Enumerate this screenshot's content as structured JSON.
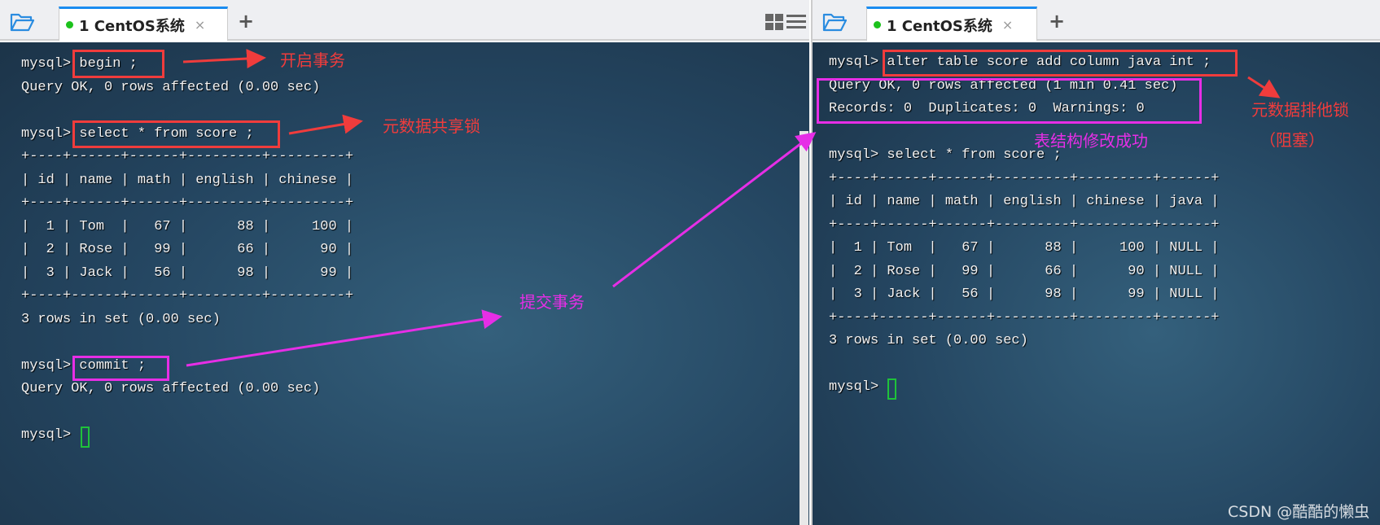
{
  "left": {
    "tab": {
      "label": "1 CentOS系统",
      "close": "×",
      "new": "+",
      "status_color": "#1cc21c"
    },
    "lines": [
      "mysql> begin ;",
      "Query OK, 0 rows affected (0.00 sec)",
      "",
      "mysql> select * from score ;",
      "+----+------+------+---------+---------+",
      "| id | name | math | english | chinese |",
      "+----+------+------+---------+---------+",
      "|  1 | Tom  |   67 |      88 |     100 |",
      "|  2 | Rose |   99 |      66 |      90 |",
      "|  3 | Jack |   56 |      98 |      99 |",
      "+----+------+------+---------+---------+",
      "3 rows in set (0.00 sec)",
      "",
      "mysql> commit ;",
      "Query OK, 0 rows affected (0.00 sec)",
      "",
      "mysql> "
    ],
    "annotations": {
      "begin": "开启事务",
      "shared_lock": "元数据共享锁",
      "commit": "提交事务"
    }
  },
  "right": {
    "tab": {
      "label": "1 CentOS系统",
      "close": "×",
      "new": "+",
      "status_color": "#1cc21c"
    },
    "lines": [
      "mysql> alter table score add column java int ;",
      "Query OK, 0 rows affected (1 min 0.41 sec)",
      "Records: 0  Duplicates: 0  Warnings: 0",
      "",
      "mysql> select * from score ;",
      "+----+------+------+---------+---------+------+",
      "| id | name | math | english | chinese | java |",
      "+----+------+------+---------+---------+------+",
      "|  1 | Tom  |   67 |      88 |     100 | NULL |",
      "|  2 | Rose |   99 |      66 |      90 | NULL |",
      "|  3 | Jack |   56 |      98 |      99 | NULL |",
      "+----+------+------+---------+---------+------+",
      "3 rows in set (0.00 sec)",
      "",
      "mysql> "
    ],
    "annotations": {
      "exclusive_lock": "元数据排他锁",
      "blocked": "（阻塞）",
      "success": "表结构修改成功"
    }
  },
  "watermark": "CSDN @酷酷的懒虫",
  "colors": {
    "red": "#f03c3c",
    "magenta": "#e62ee6",
    "cursor": "#1fc23a"
  }
}
